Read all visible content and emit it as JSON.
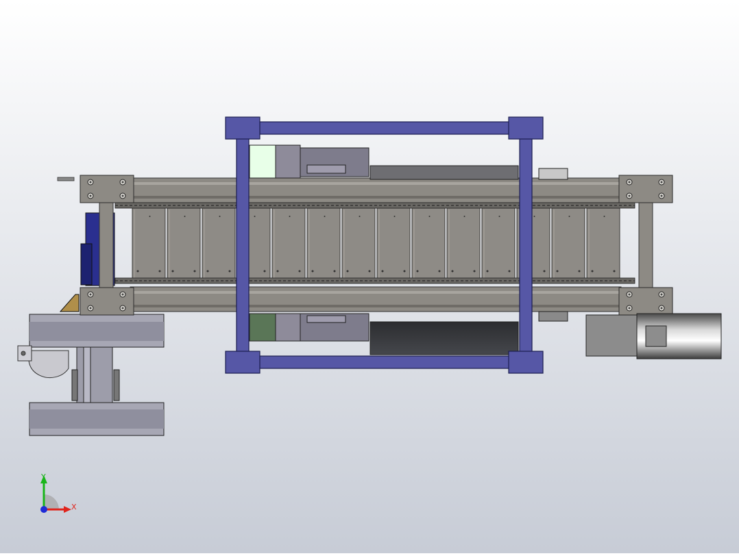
{
  "viewport": {
    "background_top": "#ffffff",
    "background_bottom": "#c7ccd6"
  },
  "colors": {
    "frame_blue": "#5657a6",
    "frame_blue_dark": "#2d2f6e",
    "steel": "#8d8a84",
    "steel_light": "#a8a59f",
    "steel_dark": "#55534f",
    "panel": "#8e8b86",
    "motor_dark": "#3a3b3e",
    "mint": "#e8ffe8",
    "green_box": "#5a7657",
    "drive_blue": "#2a2f8f",
    "wood": "#b08f4a"
  },
  "triad": {
    "x_label": "X",
    "y_label": "Y",
    "x_color": "#e0241c",
    "y_color": "#19b519",
    "z_color": "#1f2bd6"
  }
}
